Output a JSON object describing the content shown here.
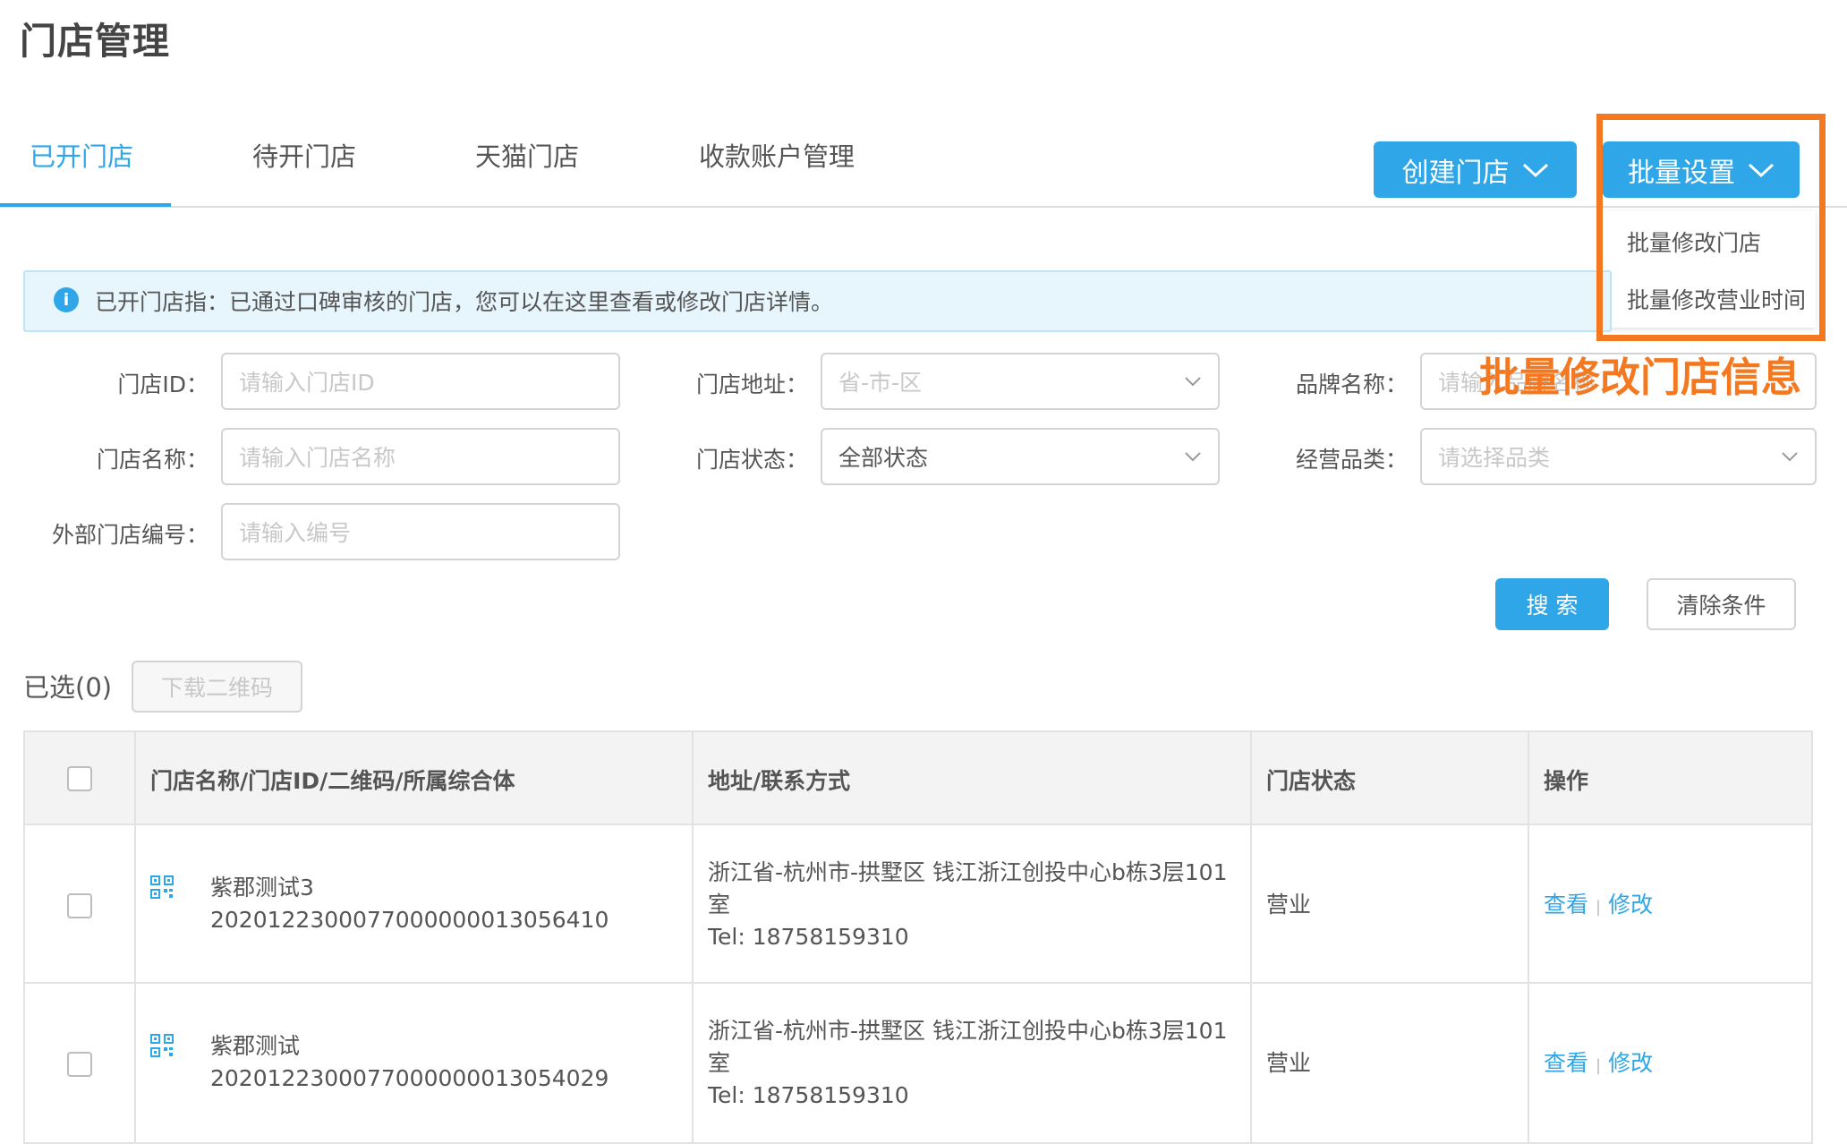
{
  "page": {
    "title": "门店管理"
  },
  "tabs": [
    {
      "label": "已开门店",
      "active": true
    },
    {
      "label": "待开门店"
    },
    {
      "label": "天猫门店"
    },
    {
      "label": "收款账户管理"
    }
  ],
  "actions": {
    "create": "创建门店",
    "batch": "批量设置",
    "batch_menu": [
      "批量修改门店",
      "批量修改营业时间"
    ],
    "annotation": "批量修改门店信息"
  },
  "info": {
    "text": "已开门店指：已通过口碑审核的门店，您可以在这里查看或修改门店详情。"
  },
  "filters": {
    "store_id": {
      "label": "门店ID：",
      "placeholder": "请输入门店ID"
    },
    "store_name": {
      "label": "门店名称：",
      "placeholder": "请输入门店名称"
    },
    "external_no": {
      "label": "外部门店编号：",
      "placeholder": "请输入编号"
    },
    "address": {
      "label": "门店地址：",
      "placeholder": "省-市-区"
    },
    "status": {
      "label": "门店状态：",
      "value": "全部状态"
    },
    "brand": {
      "label": "品牌名称：",
      "placeholder": "请输入品牌名称"
    },
    "category": {
      "label": "经营品类：",
      "placeholder": "请选择品类"
    },
    "search_btn": "搜 索",
    "clear_btn": "清除条件"
  },
  "selection": {
    "label": "已选(0)",
    "download_btn": "下载二维码"
  },
  "table": {
    "headers": [
      "门店名称/门店ID/二维码/所属综合体",
      "地址/联系方式",
      "门店状态",
      "操作"
    ],
    "rows": [
      {
        "name": "紫郡测试3",
        "id": "2020122300077000000013056410",
        "address_line1": "浙江省-杭州市-拱墅区 钱江浙江创投中心b栋3层101",
        "address_line2": "室",
        "tel": "Tel:  18758159310",
        "status": "营业",
        "view": "查看",
        "edit": "修改"
      },
      {
        "name": "紫郡测试",
        "id": "2020122300077000000013054029",
        "address_line1": "浙江省-杭州市-拱墅区 钱江浙江创投中心b栋3层101",
        "address_line2": "室",
        "tel": "Tel:  18758159310",
        "status": "营业",
        "view": "查看",
        "edit": "修改"
      }
    ]
  },
  "colors": {
    "accent": "#2fa6e7",
    "highlight": "#f47820"
  }
}
